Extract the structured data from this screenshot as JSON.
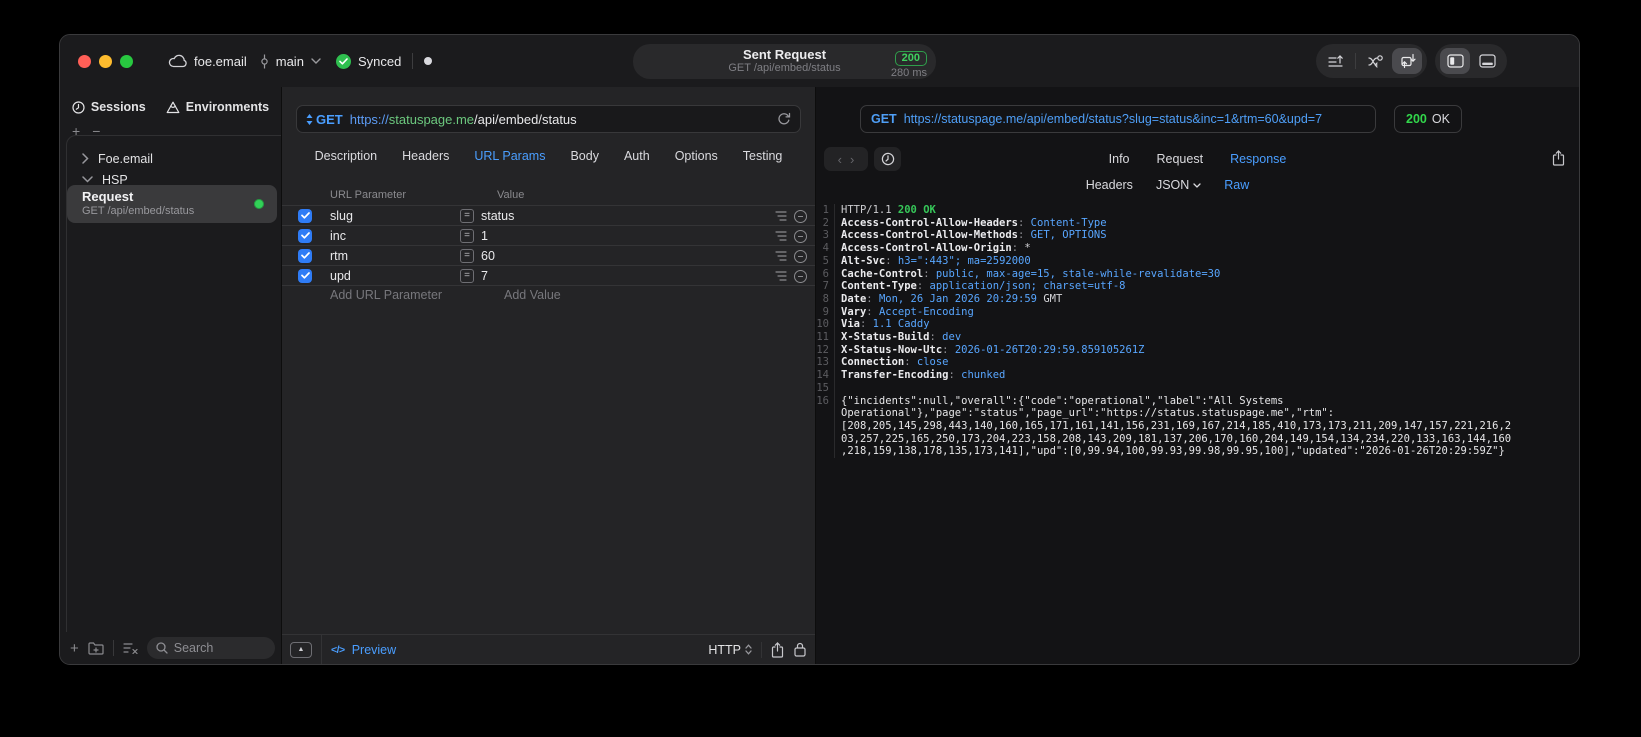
{
  "accent_blue": "#4a9eff",
  "status_green": "#32d158",
  "titlebar": {
    "project": "foe.email",
    "branch": "main",
    "sync_label": "Synced",
    "center": {
      "title": "Sent Request",
      "subtitle": "GET /api/embed/status",
      "status_code": "200",
      "duration": "280 ms"
    }
  },
  "icons": {
    "plus": "+",
    "minus": "−",
    "collapse": "▲",
    "eq": "=",
    "back": "‹",
    "forward": "›",
    "code_preview": "</>"
  },
  "sidebar": {
    "tabs": [
      {
        "label": "Sessions",
        "icon": "clock-icon"
      },
      {
        "label": "Environments",
        "icon": "environments-icon"
      }
    ],
    "tree": [
      {
        "label": "Foe.email",
        "expanded": false
      },
      {
        "label": "HSP",
        "expanded": true
      }
    ],
    "request_item": {
      "title": "Request",
      "subtitle": "GET /api/embed/status"
    },
    "search_placeholder": "Search"
  },
  "request_panel": {
    "method": "GET",
    "url_scheme": "https://",
    "url_host": "statuspage.me",
    "url_path": "/api/embed/status",
    "tabs": [
      "Description",
      "Headers",
      "URL Params",
      "Body",
      "Auth",
      "Options",
      "Testing"
    ],
    "active_tab": "URL Params",
    "table": {
      "columns": [
        "URL Parameter",
        "Value"
      ],
      "rows": [
        {
          "name": "slug",
          "value": "status",
          "enabled": true
        },
        {
          "name": "inc",
          "value": "1",
          "enabled": true
        },
        {
          "name": "rtm",
          "value": "60",
          "enabled": true
        },
        {
          "name": "upd",
          "value": "7",
          "enabled": true
        }
      ],
      "add_name_placeholder": "Add URL Parameter",
      "add_value_placeholder": "Add Value"
    },
    "footer": {
      "preview_label": "Preview",
      "protocol": "HTTP"
    }
  },
  "response_panel": {
    "method": "GET",
    "url": "https://statuspage.me/api/embed/status?slug=status&inc=1&rtm=60&upd=7",
    "status_code": "200",
    "status_text": "OK",
    "tabs": [
      "Info",
      "Request",
      "Response"
    ],
    "active_tab": "Response",
    "subtabs": [
      "Headers",
      "JSON",
      "Raw"
    ],
    "active_subtab": "Raw",
    "status_line": {
      "protocol": "HTTP/1.1",
      "status": "200 OK"
    },
    "headers": [
      {
        "name": "Access-Control-Allow-Headers",
        "segments": [
          {
            "t": "Content-Type",
            "c": "blue"
          }
        ]
      },
      {
        "name": "Access-Control-Allow-Methods",
        "segments": [
          {
            "t": "GET, OPTIONS",
            "c": "blue"
          }
        ]
      },
      {
        "name": "Access-Control-Allow-Origin",
        "segments": [
          {
            "t": "*",
            "c": "plain"
          }
        ]
      },
      {
        "name": "Alt-Svc",
        "segments": [
          {
            "t": "h3=\":443\"; ma=2592000",
            "c": "blue"
          }
        ]
      },
      {
        "name": "Cache-Control",
        "segments": [
          {
            "t": "public, max-age=15, stale-while-revalidate=30",
            "c": "blue"
          }
        ]
      },
      {
        "name": "Content-Type",
        "segments": [
          {
            "t": "application/json; charset=utf-8",
            "c": "blue"
          }
        ]
      },
      {
        "name": "Date",
        "segments": [
          {
            "t": "Mon, 26 Jan 2026 20:29:59",
            "c": "blue"
          },
          {
            "t": " GMT",
            "c": "plain"
          }
        ]
      },
      {
        "name": "Vary",
        "segments": [
          {
            "t": "Accept-Encoding",
            "c": "blue"
          }
        ]
      },
      {
        "name": "Via",
        "segments": [
          {
            "t": "1.1 Caddy",
            "c": "blue"
          }
        ]
      },
      {
        "name": "X-Status-Build",
        "segments": [
          {
            "t": "dev",
            "c": "blue"
          }
        ]
      },
      {
        "name": "X-Status-Now-Utc",
        "segments": [
          {
            "t": "2026-01-26T20:29:59.859105261Z",
            "c": "blue"
          }
        ]
      },
      {
        "name": "Connection",
        "segments": [
          {
            "t": "close",
            "c": "blue"
          }
        ]
      },
      {
        "name": "Transfer-Encoding",
        "segments": [
          {
            "t": "chunked",
            "c": "blue"
          }
        ]
      }
    ],
    "body": "{\"incidents\":null,\"overall\":{\"code\":\"operational\",\"label\":\"All Systems Operational\"},\"page\":\"status\",\"page_url\":\"https://status.statuspage.me\",\"rtm\":[208,205,145,298,443,140,160,165,171,161,141,156,231,169,167,214,185,410,173,173,211,209,147,157,221,216,203,257,225,165,250,173,204,223,158,208,143,209,181,137,206,170,160,204,149,154,134,234,220,133,163,144,160,218,159,138,178,135,173,141],\"upd\":[0,99.94,100,99.93,99.98,99.95,100],\"updated\":\"2026-01-26T20:29:59Z\"}"
  }
}
